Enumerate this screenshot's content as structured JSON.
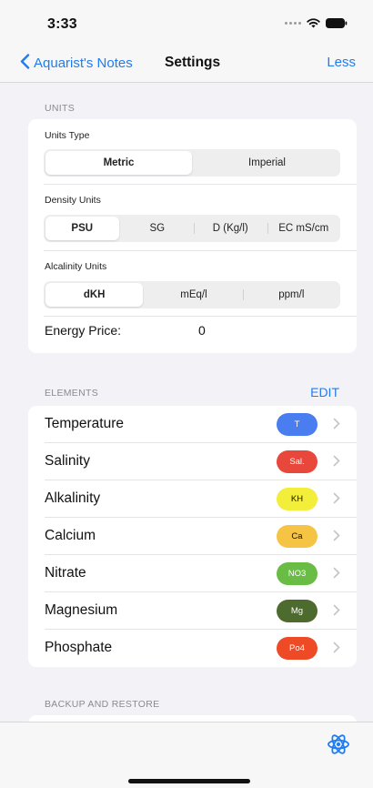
{
  "status": {
    "time": "3:33"
  },
  "nav": {
    "back_label": "Aquarist's Notes",
    "title": "Settings",
    "right_label": "Less"
  },
  "units": {
    "header": "UNITS",
    "type_label": "Units Type",
    "type_options": [
      "Metric",
      "Imperial"
    ],
    "type_selected": "Metric",
    "density_label": "Density Units",
    "density_options": [
      "PSU",
      "SG",
      "D (Kg/l)",
      "EC mS/cm"
    ],
    "density_selected": "PSU",
    "alkalinity_label": "Alcalinity Units",
    "alkalinity_options": [
      "dKH",
      "mEq/l",
      "ppm/l"
    ],
    "alkalinity_selected": "dKH",
    "energy_label": "Energy Price:",
    "energy_value": "0"
  },
  "elements": {
    "header": "ELEMENTS",
    "edit_label": "EDIT",
    "items": [
      {
        "name": "Temperature",
        "badge": "T",
        "color": "#4a7df0",
        "text_color": "#ffffff"
      },
      {
        "name": "Salinity",
        "badge": "Sal.",
        "color": "#e8473b",
        "text_color": "#ffffff"
      },
      {
        "name": "Alkalinity",
        "badge": "KH",
        "color": "#f2ee3a",
        "text_color": "#111111"
      },
      {
        "name": "Calcium",
        "badge": "Ca",
        "color": "#f6c445",
        "text_color": "#111111"
      },
      {
        "name": "Nitrate",
        "badge": "NO3",
        "color": "#69bd45",
        "text_color": "#ffffff"
      },
      {
        "name": "Magnesium",
        "badge": "Mg",
        "color": "#4d6b2f",
        "text_color": "#ffffff"
      },
      {
        "name": "Phosphate",
        "badge": "Po4",
        "color": "#ee4a25",
        "text_color": "#ffffff"
      }
    ]
  },
  "backup": {
    "header": "BACKUP AND RESTORE"
  },
  "colors": {
    "accent": "#1f7cf2",
    "background": "#f2f2f7"
  }
}
